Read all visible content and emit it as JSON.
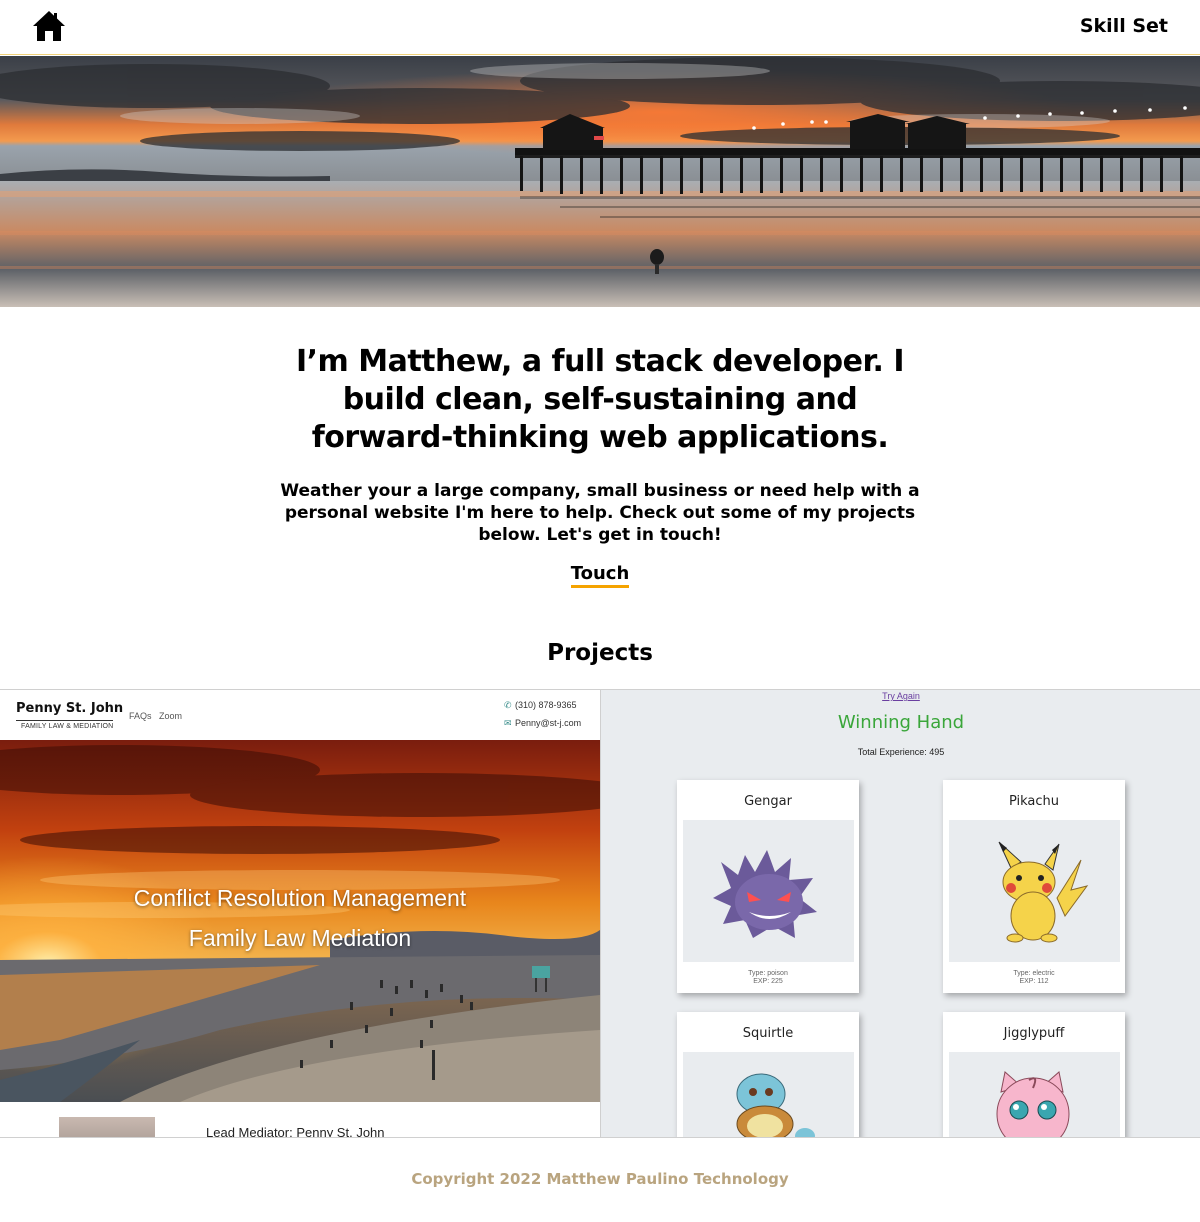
{
  "nav": {
    "home_icon": "home-icon",
    "skill_set_label": "Skill Set"
  },
  "intro": {
    "headline": "I’m Matthew, a full stack developer. I build clean, self-sustaining and forward-thinking web applications.",
    "subtext": "Weather your a large company, small business or need help with a personal website I'm here to help. Check out some of my projects below. Let's get in touch!",
    "touch_label": "Touch"
  },
  "projects": {
    "heading": "Projects",
    "mediation_site": {
      "brand": "Penny St. John",
      "brand_sub": "FAMILY LAW & MEDIATION",
      "nav_faqs": "FAQs",
      "nav_zoom": "Zoom",
      "phone": "(310) 878-9365",
      "email": "Penny@st-j.com",
      "banner_line1": "Conflict Resolution Management",
      "banner_line2": "Family Law Mediation",
      "lead": "Lead Mediator: Penny St. John"
    },
    "pokemon_site": {
      "try_again": "Try Again",
      "title": "Winning Hand",
      "total_experience": "Total Experience: 495",
      "cards": [
        {
          "name": "Gengar",
          "type": "Type: poison",
          "exp": "EXP: 225"
        },
        {
          "name": "Pikachu",
          "type": "Type: electric",
          "exp": "EXP: 112"
        },
        {
          "name": "Squirtle"
        },
        {
          "name": "Jigglypuff"
        }
      ]
    }
  },
  "footer": {
    "copyright": "Copyright 2022 Matthew Paulino Technology"
  },
  "colors": {
    "touch_underline": "#f5a300",
    "footer_text": "#b9a47f",
    "winning_green": "#3aa63a"
  }
}
